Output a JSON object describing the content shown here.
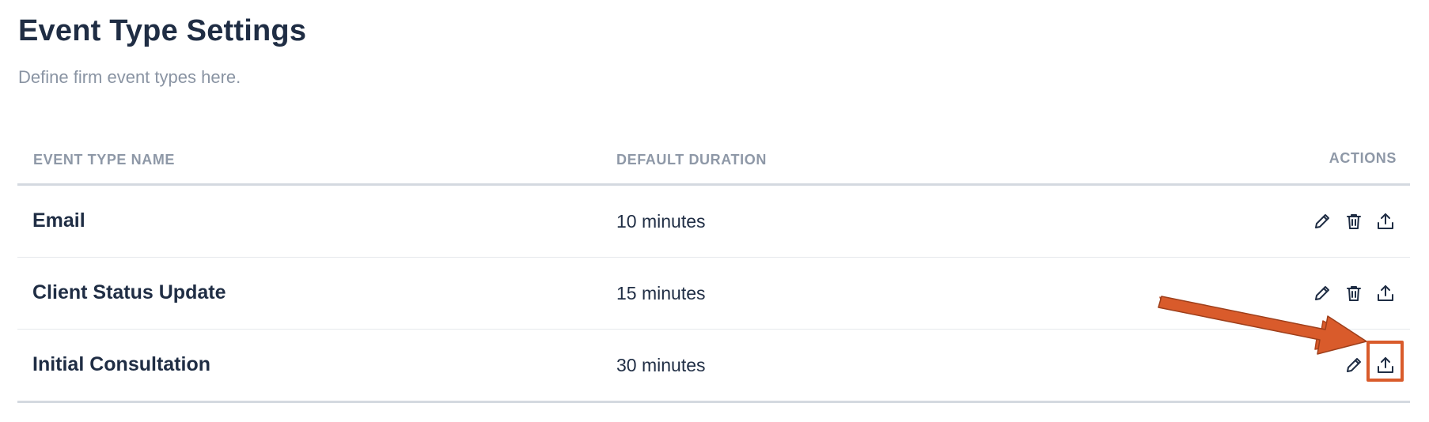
{
  "header": {
    "title": "Event Type Settings",
    "subtitle": "Define firm event types here."
  },
  "table": {
    "columns": {
      "name": "EVENT TYPE NAME",
      "duration": "DEFAULT DURATION",
      "actions": "ACTIONS"
    },
    "rows": [
      {
        "name": "Email",
        "duration": "10 minutes",
        "actions": [
          "pencil-icon",
          "trash-icon",
          "upload-icon"
        ]
      },
      {
        "name": "Client Status Update",
        "duration": "15 minutes",
        "actions": [
          "pencil-icon",
          "trash-icon",
          "upload-icon"
        ]
      },
      {
        "name": "Initial Consultation",
        "duration": "30 minutes",
        "actions": [
          "pencil-icon",
          "upload-icon"
        ]
      }
    ]
  },
  "annotation": {
    "type": "arrow-with-highlight-box",
    "target": "upload-icon",
    "color": "#d95b2b"
  },
  "colors": {
    "title": "#1f2d44",
    "subtitle": "#8a94a3",
    "header_text": "#8e98a7",
    "divider": "#d4d9e0",
    "accent_annotation": "#d95b2b"
  }
}
